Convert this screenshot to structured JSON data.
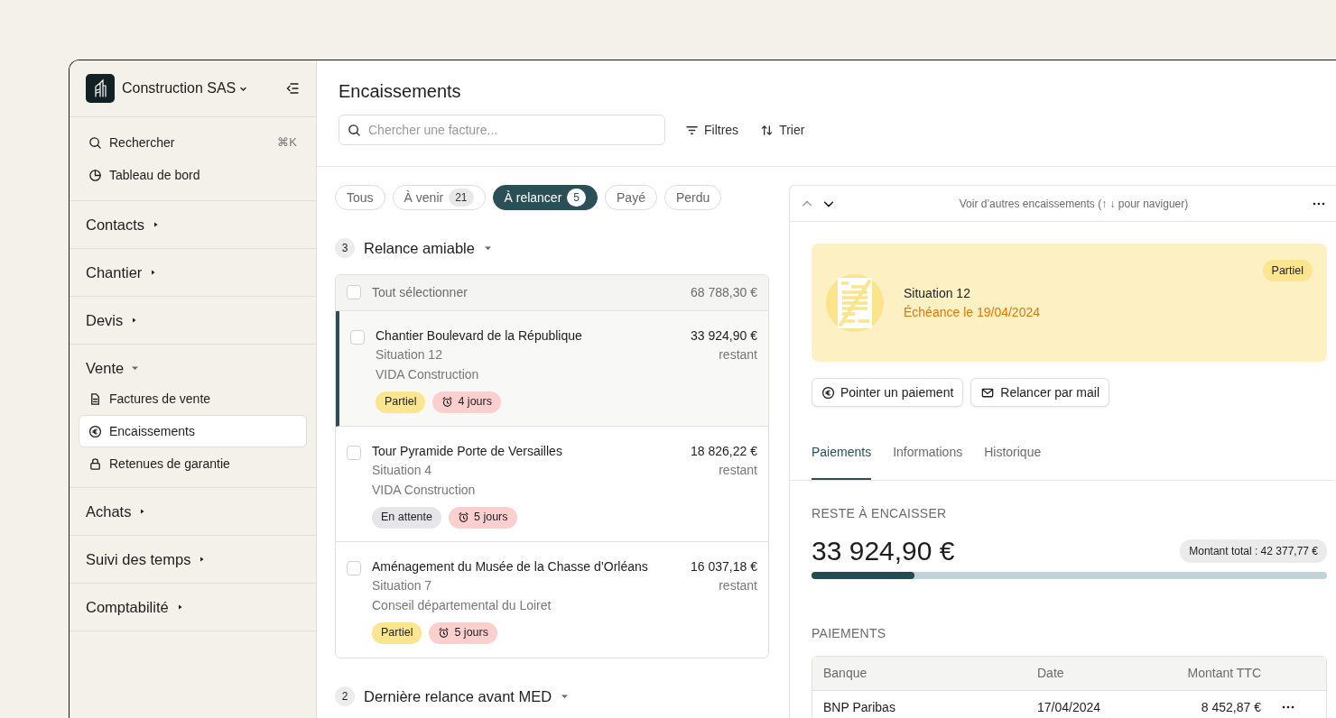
{
  "workspace": {
    "name": "Construction SAS"
  },
  "sidebar": {
    "quick": [
      {
        "label": "Rechercher",
        "kind": "search",
        "shortcut": "⌘K"
      },
      {
        "label": "Tableau de bord",
        "kind": "pie"
      }
    ],
    "sections": [
      {
        "label": "Contacts",
        "expanded": false
      },
      {
        "label": "Chantier",
        "expanded": false
      },
      {
        "label": "Devis",
        "expanded": false
      },
      {
        "label": "Vente",
        "expanded": true,
        "children": [
          {
            "label": "Factures de vente",
            "kind": "doc",
            "selected": false
          },
          {
            "label": "Encaissements",
            "kind": "euro",
            "selected": true
          },
          {
            "label": "Retenues de garantie",
            "kind": "lock",
            "selected": false
          }
        ]
      },
      {
        "label": "Achats",
        "expanded": false
      },
      {
        "label": "Suivi des temps",
        "expanded": false
      },
      {
        "label": "Comptabilité",
        "expanded": false
      }
    ]
  },
  "page": {
    "title": "Encaissements",
    "search": {
      "placeholder": "Chercher une facture..."
    },
    "tools": [
      {
        "label": "Filtres",
        "kind": "filter"
      },
      {
        "label": "Trier",
        "kind": "sort"
      }
    ]
  },
  "filters": [
    {
      "label": "Tous",
      "selected": false
    },
    {
      "label": "À venir",
      "count": "21",
      "selected": false
    },
    {
      "label": "À relancer",
      "count": "5",
      "selected": true
    },
    {
      "label": "Payé",
      "selected": false
    },
    {
      "label": "Perdu",
      "selected": false
    }
  ],
  "groups": [
    {
      "count": "3",
      "title": "Relance amiable",
      "select_all": "Tout sélectionner",
      "select_all_checked": false,
      "total": "68 788,30 €",
      "items": [
        {
          "title": "Chantier Boulevard de la République",
          "subtitle": "Situation 12",
          "client": "VIDA Construction",
          "amount": "33 924,90 €",
          "amount_note": "restant",
          "selected": true,
          "checked": false,
          "tags": [
            {
              "kind": "status",
              "label": "Partiel",
              "color": "#fbe68f"
            },
            {
              "kind": "delay",
              "label": "4 jours",
              "color": "#fccfcf"
            }
          ]
        },
        {
          "title": "Tour Pyramide Porte de Versailles",
          "subtitle": "Situation 4",
          "client": "VIDA Construction",
          "amount": "18 826,22 €",
          "amount_note": "restant",
          "selected": false,
          "checked": false,
          "tags": [
            {
              "kind": "status",
              "label": "En attente",
              "color": "#e6e6ea"
            },
            {
              "kind": "delay",
              "label": "5 jours",
              "color": "#fccfcf"
            }
          ]
        },
        {
          "title": "Aménagement du Musée de la Chasse d’Orléans",
          "subtitle": "Situation 7",
          "client": "Conseil départemental du Loiret",
          "amount": "16 037,18 €",
          "amount_note": "restant",
          "selected": false,
          "checked": false,
          "tags": [
            {
              "kind": "status",
              "label": "Partiel",
              "color": "#fbe68f"
            },
            {
              "kind": "delay",
              "label": "5 jours",
              "color": "#fccfcf"
            }
          ]
        }
      ]
    },
    {
      "count": "2",
      "title": "Dernière relance avant MED"
    }
  ],
  "detail": {
    "nav_hint": "Voir d’autres encaissements (↑ ↓ pour naviguer)",
    "invoice": {
      "title": "Situation 12",
      "due": "Échéance le 19/04/2024",
      "status": "Partiel"
    },
    "actions": [
      {
        "label": "Pointer un paiement",
        "kind": "euro"
      },
      {
        "label": "Relancer par mail",
        "kind": "mail"
      }
    ],
    "tabs": [
      {
        "label": "Paiements",
        "selected": true
      },
      {
        "label": "Informations",
        "selected": false
      },
      {
        "label": "Historique",
        "selected": false
      }
    ],
    "remaining": {
      "label": "RESTE À ENCAISSER",
      "amount": "33 924,90 €",
      "total": "Montant total : 42 377,77 €",
      "level": 0.2
    },
    "payments": {
      "title": "PAIEMENTS",
      "columns": [
        "Banque",
        "Date",
        "Montant TTC"
      ],
      "rows": [
        [
          "BNP Paribas",
          "17/04/2024",
          "8 452,87 €"
        ]
      ]
    }
  }
}
